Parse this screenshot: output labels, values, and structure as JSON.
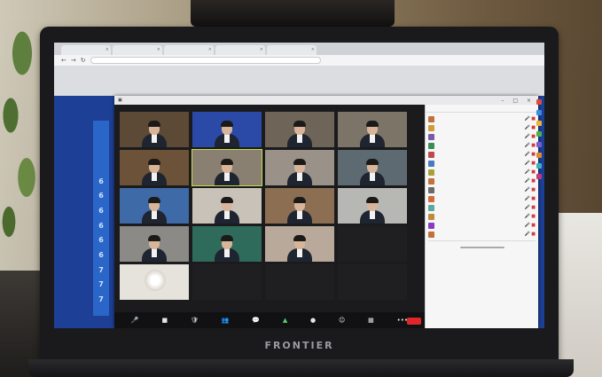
{
  "laptop": {
    "brand": "FRONTIER"
  },
  "browser": {
    "tabs": [
      "",
      "",
      "",
      "",
      ""
    ],
    "tab_close": "×",
    "nav": [
      "←",
      "→",
      "↻"
    ]
  },
  "bg_strip": {
    "values": [
      "6",
      "6",
      "6",
      "6",
      "6",
      "6",
      "7",
      "7",
      "7"
    ]
  },
  "zoom": {
    "window_controls": "– □ ×",
    "toolbar": [
      {
        "key": "mute",
        "icon": "🎤",
        "label": ""
      },
      {
        "key": "video",
        "icon": "■",
        "label": ""
      },
      {
        "key": "security",
        "icon": "🛡",
        "label": ""
      },
      {
        "key": "participants",
        "icon": "👥",
        "label": ""
      },
      {
        "key": "chat",
        "icon": "💬",
        "label": ""
      },
      {
        "key": "share",
        "icon": "▲",
        "label": ""
      },
      {
        "key": "record",
        "icon": "●",
        "label": ""
      },
      {
        "key": "reactions",
        "icon": "☺",
        "label": ""
      },
      {
        "key": "rooms",
        "icon": "▦",
        "label": ""
      },
      {
        "key": "more",
        "icon": "•••",
        "label": ""
      }
    ],
    "leave_label": "",
    "tiles": [
      {
        "type": "video",
        "name": "",
        "bg": "#5c4a36"
      },
      {
        "type": "video",
        "name": "",
        "bg": "#2b4aa8"
      },
      {
        "type": "video",
        "name": "",
        "bg": "#6f6458"
      },
      {
        "type": "video",
        "name": "",
        "bg": "#7d7468"
      },
      {
        "type": "video",
        "name": "",
        "bg": "#6b5238"
      },
      {
        "type": "video",
        "name": "",
        "bg": "#8a8072",
        "active": true
      },
      {
        "type": "video",
        "name": "",
        "bg": "#9a9288"
      },
      {
        "type": "video",
        "name": "",
        "bg": "#5e6a72"
      },
      {
        "type": "video",
        "name": "",
        "bg": "#3e6aa8"
      },
      {
        "type": "video",
        "name": "",
        "bg": "#c9c2b8"
      },
      {
        "type": "video",
        "name": "",
        "bg": "#8c6f52"
      },
      {
        "type": "video",
        "name": "",
        "bg": "#b7b8b4"
      },
      {
        "type": "video",
        "name": "",
        "bg": "#8c8a86"
      },
      {
        "type": "video",
        "name": "",
        "bg": "#2f6b5a"
      },
      {
        "type": "video",
        "name": "",
        "bg": "#b9a99a"
      },
      {
        "type": "text",
        "name": "",
        "center": ""
      },
      {
        "type": "photo",
        "name": "",
        "bg": "#e6e2dc"
      },
      {
        "type": "text",
        "name": "",
        "center": ""
      },
      {
        "type": "text",
        "name": "",
        "center": ""
      },
      {
        "type": "text",
        "name": "",
        "center": ""
      }
    ]
  },
  "participants": {
    "header": "",
    "items": [
      {
        "name": "",
        "color": "#c0713c"
      },
      {
        "name": "",
        "color": "#d39a3a"
      },
      {
        "name": "",
        "color": "#7a5aa8"
      },
      {
        "name": "",
        "color": "#3a8c5a"
      },
      {
        "name": "",
        "color": "#c04a4a"
      },
      {
        "name": "",
        "color": "#4a7ac0"
      },
      {
        "name": "",
        "color": "#a8a03a"
      },
      {
        "name": "",
        "color": "#c0713c"
      },
      {
        "name": "",
        "color": "#6a6a6a"
      },
      {
        "name": "",
        "color": "#d36a3a"
      },
      {
        "name": "",
        "color": "#5aa8a0"
      },
      {
        "name": "",
        "color": "#c08a3a"
      },
      {
        "name": "",
        "color": "#8a3ac0"
      },
      {
        "name": "",
        "color": "#c0713c"
      }
    ],
    "icons": "🎤 ■",
    "footer": "",
    "chat_button": "",
    "chat_lines": [
      "",
      "",
      "",
      ""
    ]
  },
  "dock_colors": [
    "#e04a3a",
    "#3a8ce0",
    "#f0b030",
    "#4ab04a",
    "#7a5ad0",
    "#e08a2a",
    "#3ab0c0",
    "#c03a7a"
  ]
}
